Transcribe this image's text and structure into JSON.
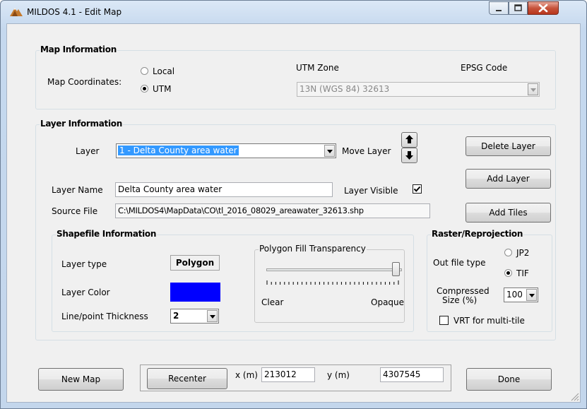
{
  "window": {
    "title": "MILDOS 4.1 - Edit Map",
    "icon": "mountain-app-icon",
    "controls": [
      "minimize-icon",
      "maximize-icon",
      "close-icon"
    ]
  },
  "map_info": {
    "group_title": "Map Information",
    "coords_label": "Map Coordinates:",
    "local_label": "Local",
    "utm_label": "UTM",
    "selected": "UTM",
    "utm_zone_label": "UTM Zone",
    "epsg_label": "EPSG Code",
    "utm_value": "13N  (WGS 84)  32613"
  },
  "layer_info": {
    "group_title": "Layer Information",
    "layer_label": "Layer",
    "layer_value": "1 - Delta County area water",
    "move_layer_label": "Move Layer",
    "delete_layer": "Delete Layer",
    "add_layer": "Add Layer",
    "add_tiles": "Add Tiles",
    "layer_name_label": "Layer Name",
    "layer_name_value": "Delta County area water",
    "layer_visible_label": "Layer Visible",
    "layer_visible": true,
    "source_file_label": "Source File",
    "source_file_value": "C:\\MILDOS4\\MapData\\CO\\tl_2016_08029_areawater_32613.shp"
  },
  "shapefile": {
    "group_title": "Shapefile Information",
    "layer_type_label": "Layer type",
    "layer_type_value": "Polygon",
    "layer_color_label": "Layer Color",
    "layer_color": "#0000FF",
    "thickness_label": "Line/point Thickness",
    "thickness_value": "2",
    "transparency_title": "Polygon Fill Transparency",
    "clear_label": "Clear",
    "opaque_label": "Opaque",
    "transparency_level": 1.0
  },
  "raster": {
    "group_title": "Raster/Reprojection",
    "out_file_label": "Out file type",
    "jp2_label": "JP2",
    "tif_label": "TIF",
    "selected": "TIF",
    "compressed_label_1": "Compressed",
    "compressed_label_2": "Size (%)",
    "compressed_value": "100",
    "vrt_label": "VRT for multi-tile",
    "vrt_checked": false
  },
  "footer": {
    "new_map": "New Map",
    "recenter": "Recenter",
    "x_label": "x (m)",
    "x_value": "213012",
    "y_label": "y (m)",
    "y_value": "4307545",
    "done": "Done"
  }
}
